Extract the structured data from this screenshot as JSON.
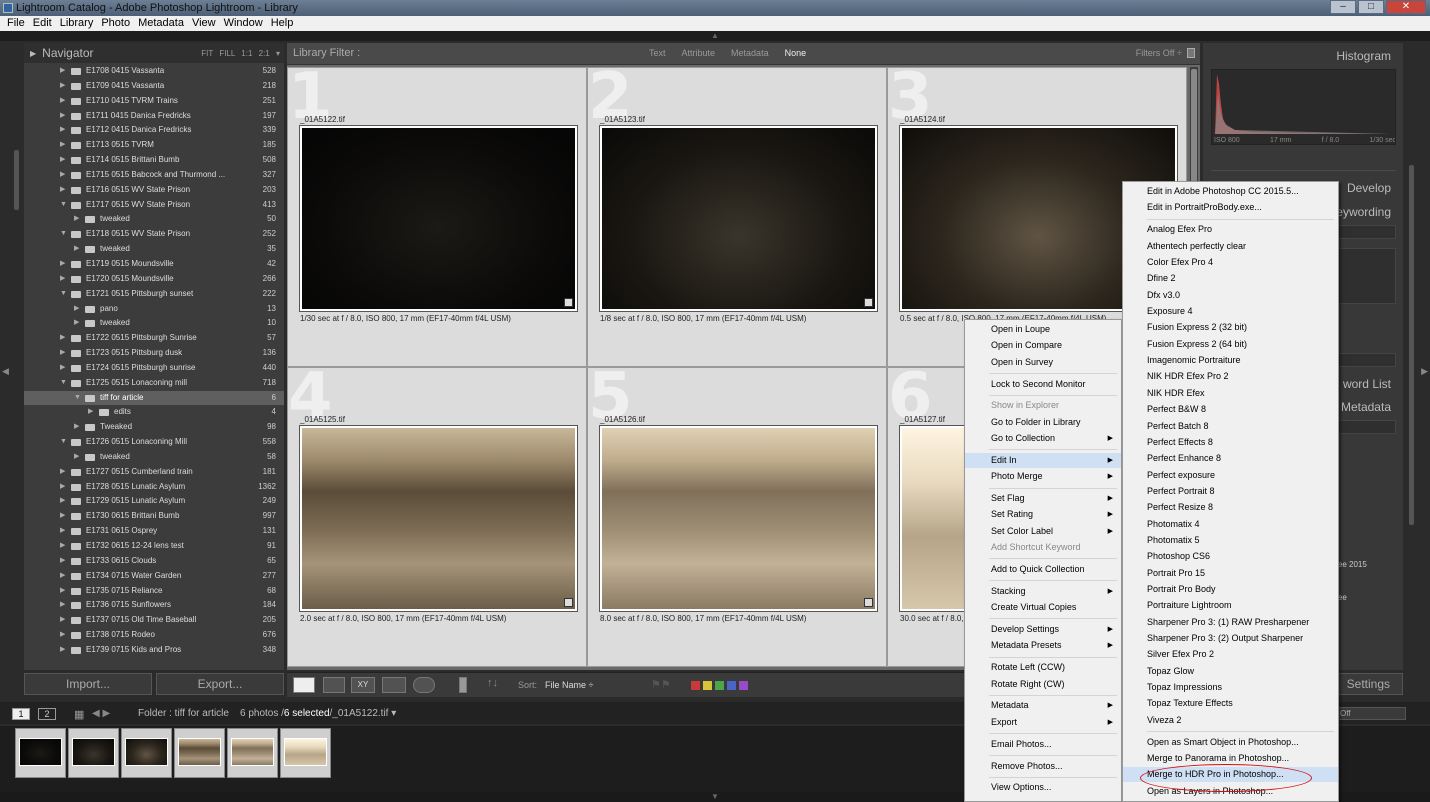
{
  "window": {
    "title": "Lightroom Catalog - Adobe Photoshop Lightroom - Library"
  },
  "menubar": [
    "File",
    "Edit",
    "Library",
    "Photo",
    "Metadata",
    "View",
    "Window",
    "Help"
  ],
  "navigator": {
    "title": "Navigator",
    "modes": "FIT  FILL  1:1  2:1 ▾"
  },
  "folders": [
    {
      "name": "E1708 0415 Vassanta",
      "count": "528",
      "lvl": 0,
      "exp": false
    },
    {
      "name": "E1709 0415 Vassanta",
      "count": "218",
      "lvl": 0,
      "exp": false
    },
    {
      "name": "E1710 0415 TVRM Trains",
      "count": "251",
      "lvl": 0,
      "exp": false
    },
    {
      "name": "E1711 0415 Danica Fredricks",
      "count": "197",
      "lvl": 0,
      "exp": false
    },
    {
      "name": "E1712 0415 Danica Fredricks",
      "count": "339",
      "lvl": 0,
      "exp": false
    },
    {
      "name": "E1713 0515 TVRM",
      "count": "185",
      "lvl": 0,
      "exp": false
    },
    {
      "name": "E1714 0515 Brittani Bumb",
      "count": "508",
      "lvl": 0,
      "exp": false
    },
    {
      "name": "E1715 0515 Babcock and Thurmond ...",
      "count": "327",
      "lvl": 0,
      "exp": false
    },
    {
      "name": "E1716 0515 WV State Prison",
      "count": "203",
      "lvl": 0,
      "exp": false
    },
    {
      "name": "E1717 0515 WV State Prison",
      "count": "413",
      "lvl": 0,
      "exp": true
    },
    {
      "name": "tweaked",
      "count": "50",
      "lvl": 1,
      "exp": false
    },
    {
      "name": "E1718 0515 WV State Prison",
      "count": "252",
      "lvl": 0,
      "exp": true
    },
    {
      "name": "tweaked",
      "count": "35",
      "lvl": 1,
      "exp": false
    },
    {
      "name": "E1719 0515 Moundsville",
      "count": "42",
      "lvl": 0,
      "exp": false
    },
    {
      "name": "E1720 0515 Moundsville",
      "count": "266",
      "lvl": 0,
      "exp": false
    },
    {
      "name": "E1721 0515 Pittsburgh sunset",
      "count": "222",
      "lvl": 0,
      "exp": true
    },
    {
      "name": "pano",
      "count": "13",
      "lvl": 1,
      "exp": false
    },
    {
      "name": "tweaked",
      "count": "10",
      "lvl": 1,
      "exp": false
    },
    {
      "name": "E1722 0515 Pittsburgh Sunrise",
      "count": "57",
      "lvl": 0,
      "exp": false
    },
    {
      "name": "E1723 0515 Pittsburg dusk",
      "count": "136",
      "lvl": 0,
      "exp": false
    },
    {
      "name": "E1724 0515 Pittsburgh sunrise",
      "count": "440",
      "lvl": 0,
      "exp": false
    },
    {
      "name": "E1725 0515 Lonaconing mill",
      "count": "718",
      "lvl": 0,
      "exp": true
    },
    {
      "name": "tiff for article",
      "count": "6",
      "lvl": 1,
      "exp": true,
      "sel": true
    },
    {
      "name": "edits",
      "count": "4",
      "lvl": 2,
      "exp": false
    },
    {
      "name": "Tweaked",
      "count": "98",
      "lvl": 1,
      "exp": false
    },
    {
      "name": "E1726 0515 Lonaconing Mill",
      "count": "558",
      "lvl": 0,
      "exp": true
    },
    {
      "name": "tweaked",
      "count": "58",
      "lvl": 1,
      "exp": false
    },
    {
      "name": "E1727 0515 Cumberland train",
      "count": "181",
      "lvl": 0,
      "exp": false
    },
    {
      "name": "E1728 0515 Lunatic Asylum",
      "count": "1362",
      "lvl": 0,
      "exp": false
    },
    {
      "name": "E1729 0515 Lunatic Asylum",
      "count": "249",
      "lvl": 0,
      "exp": false
    },
    {
      "name": "E1730 0615 Brittani Bumb",
      "count": "997",
      "lvl": 0,
      "exp": false
    },
    {
      "name": "E1731 0615 Osprey",
      "count": "131",
      "lvl": 0,
      "exp": false
    },
    {
      "name": "E1732 0615 12-24 lens test",
      "count": "91",
      "lvl": 0,
      "exp": false
    },
    {
      "name": "E1733 0615 Clouds",
      "count": "65",
      "lvl": 0,
      "exp": false
    },
    {
      "name": "E1734 0715 Water Garden",
      "count": "277",
      "lvl": 0,
      "exp": false
    },
    {
      "name": "E1735 0715 Reliance",
      "count": "68",
      "lvl": 0,
      "exp": false
    },
    {
      "name": "E1736 0715 Sunflowers",
      "count": "184",
      "lvl": 0,
      "exp": false
    },
    {
      "name": "E1737 0715 Old Time Baseball",
      "count": "205",
      "lvl": 0,
      "exp": false
    },
    {
      "name": "E1738 0715 Rodeo",
      "count": "676",
      "lvl": 0,
      "exp": false
    },
    {
      "name": "E1739 0715 Kids and Pros",
      "count": "348",
      "lvl": 0,
      "exp": false
    }
  ],
  "left_buttons": {
    "import": "Import...",
    "export": "Export..."
  },
  "filter": {
    "title": "Library Filter :",
    "options": [
      "Text",
      "Attribute",
      "Metadata",
      "None"
    ],
    "active": "None",
    "status": "Filters Off ÷"
  },
  "photos": [
    {
      "num": "1",
      "file": "_01A5122.tif",
      "meta": "1/30 sec at f / 8.0, ISO 800, 17 mm (EF17-40mm f/4L USM)",
      "tone": "dark"
    },
    {
      "num": "2",
      "file": "_01A5123.tif",
      "meta": "1/8 sec at f / 8.0, ISO 800, 17 mm (EF17-40mm f/4L USM)",
      "tone": "dim"
    },
    {
      "num": "3",
      "file": "_01A5124.tif",
      "meta": "0.5 sec at f / 8.0, ISO 800, 17 mm (EF17-40mm f/4L USM)",
      "tone": "dim2"
    },
    {
      "num": "4",
      "file": "_01A5125.tif",
      "meta": "2.0 sec at f / 8.0, ISO 800, 17 mm (EF17-40mm f/4L USM)",
      "tone": "bright"
    },
    {
      "num": "5",
      "file": "_01A5126.tif",
      "meta": "8.0 sec at f / 8.0, ISO 800, 17 mm (EF17-40mm f/4L USM)",
      "tone": "bright2"
    },
    {
      "num": "6",
      "file": "_01A5127.tif",
      "meta": "30.0 sec at f / 8.0, ISO 800, 17 mm (EF17-40mm f/4L USM)",
      "tone": "bright3"
    }
  ],
  "toolbar": {
    "sort_label": "Sort:",
    "sort_value": "File Name ÷",
    "swatches": [
      "#c83a3a",
      "#d8c43a",
      "#4aa84a",
      "#4a64c8",
      "#9a4ac8"
    ]
  },
  "right_panel": {
    "histogram": "Histogram",
    "hist_meta": [
      "ISO 800",
      "17 mm",
      "f / 8.0",
      "1/30 sec"
    ],
    "develop": "Develop",
    "keywording": "eywording",
    "keyword_list": "word List",
    "metadata": "Metadata",
    "settings": "Settings",
    "field1": "tree 2015",
    "field2": "tree",
    "filter_field": "Off"
  },
  "filmstrip_bar": {
    "page1": "1",
    "page2": "2",
    "folder": "Folder : tiff for article",
    "count": "6 photos /",
    "selected": "6 selected",
    "file": "/_01A5122.tif ▾"
  },
  "context_menu": [
    {
      "label": "Open in Loupe"
    },
    {
      "label": "Open in Compare"
    },
    {
      "label": "Open in Survey"
    },
    {
      "sep": true
    },
    {
      "label": "Lock to Second Monitor"
    },
    {
      "sep": true
    },
    {
      "label": "Show in Explorer",
      "dis": true
    },
    {
      "label": "Go to Folder in Library"
    },
    {
      "label": "Go to Collection",
      "sub": true
    },
    {
      "sep": true
    },
    {
      "label": "Edit In",
      "sub": true,
      "hl": true
    },
    {
      "label": "Photo Merge",
      "sub": true
    },
    {
      "sep": true
    },
    {
      "label": "Set Flag",
      "sub": true
    },
    {
      "label": "Set Rating",
      "sub": true
    },
    {
      "label": "Set Color Label",
      "sub": true
    },
    {
      "label": "Add Shortcut Keyword",
      "dis": true
    },
    {
      "sep": true
    },
    {
      "label": "Add to Quick Collection"
    },
    {
      "sep": true
    },
    {
      "label": "Stacking",
      "sub": true
    },
    {
      "label": "Create Virtual Copies"
    },
    {
      "sep": true
    },
    {
      "label": "Develop Settings",
      "sub": true
    },
    {
      "label": "Metadata Presets",
      "sub": true
    },
    {
      "sep": true
    },
    {
      "label": "Rotate Left (CCW)"
    },
    {
      "label": "Rotate Right (CW)"
    },
    {
      "sep": true
    },
    {
      "label": "Metadata",
      "sub": true
    },
    {
      "label": "Export",
      "sub": true
    },
    {
      "sep": true
    },
    {
      "label": "Email Photos..."
    },
    {
      "sep": true
    },
    {
      "label": "Remove Photos..."
    },
    {
      "sep": true
    },
    {
      "label": "View Options..."
    }
  ],
  "edit_in_menu": [
    {
      "label": "Edit in Adobe Photoshop CC 2015.5..."
    },
    {
      "label": "Edit in PortraitProBody.exe..."
    },
    {
      "sep": true
    },
    {
      "label": "Analog Efex Pro"
    },
    {
      "label": "Athentech perfectly clear"
    },
    {
      "label": "Color Efex Pro 4"
    },
    {
      "label": "Dfine 2"
    },
    {
      "label": "Dfx v3.0"
    },
    {
      "label": "Exposure 4"
    },
    {
      "label": "Fusion Express 2 (32 bit)"
    },
    {
      "label": "Fusion Express 2 (64 bit)"
    },
    {
      "label": "Imagenomic Portraiture"
    },
    {
      "label": "NIK HDR Efex Pro 2"
    },
    {
      "label": "NIK HDR Efex"
    },
    {
      "label": "Perfect B&W 8"
    },
    {
      "label": "Perfect Batch 8"
    },
    {
      "label": "Perfect Effects 8"
    },
    {
      "label": "Perfect Enhance 8"
    },
    {
      "label": "Perfect exposure"
    },
    {
      "label": "Perfect Portrait 8"
    },
    {
      "label": "Perfect Resize 8"
    },
    {
      "label": "Photomatix 4"
    },
    {
      "label": "Photomatix 5"
    },
    {
      "label": "Photoshop CS6"
    },
    {
      "label": "Portrait Pro 15"
    },
    {
      "label": "Portrait Pro Body"
    },
    {
      "label": "Portraiture Lightroom"
    },
    {
      "label": "Sharpener Pro 3: (1) RAW Presharpener"
    },
    {
      "label": "Sharpener Pro 3: (2) Output Sharpener"
    },
    {
      "label": "Silver Efex Pro 2"
    },
    {
      "label": "Topaz Glow"
    },
    {
      "label": "Topaz Impressions"
    },
    {
      "label": "Topaz Texture Effects"
    },
    {
      "label": "Viveza 2"
    },
    {
      "sep": true
    },
    {
      "label": "Open as Smart Object in Photoshop..."
    },
    {
      "label": "Merge to Panorama in Photoshop..."
    },
    {
      "label": "Merge to HDR Pro in Photoshop...",
      "hl": true
    },
    {
      "label": "Open as Layers in Photoshop..."
    }
  ]
}
